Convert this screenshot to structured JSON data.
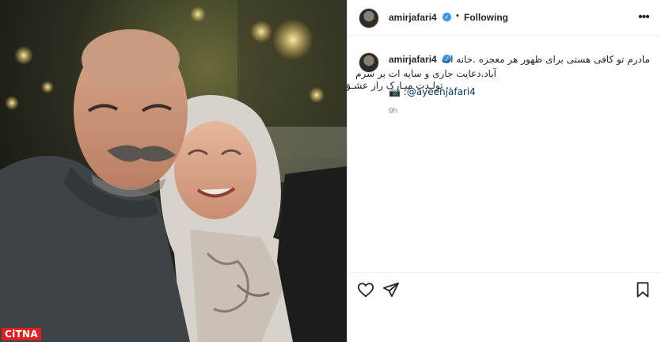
{
  "post": {
    "username": "amirjafari4",
    "separator": "•",
    "follow_status": "Following",
    "more_icon": "more-horizontal-icon",
    "caption": {
      "line1": "مادرم تو کافی هستی برای ظهور هر معجزه .خانه ات",
      "line2": "آباد.دعایت جاری و سایه ات بر سرم",
      "line3": "..  تولـدت مبـارک راز عشـق",
      "camera_icon": "camera-icon",
      "mention": ":@ayeenjafari4"
    },
    "time_ago": "9h"
  },
  "actions": {
    "like": "heart-icon",
    "share": "paper-plane-icon",
    "save": "bookmark-icon"
  },
  "watermark": "CiTNA"
}
